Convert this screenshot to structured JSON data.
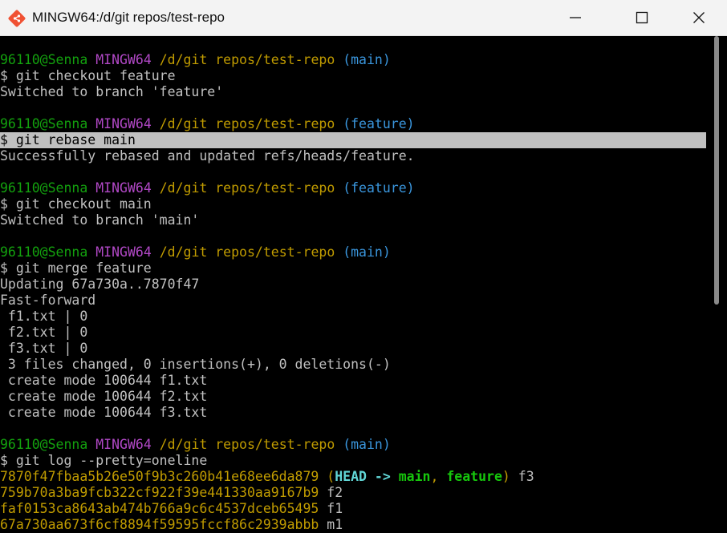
{
  "window": {
    "title": "MINGW64:/d/git repos/test-repo",
    "icon": "git-bash-icon",
    "controls": [
      "minimize-icon",
      "maximize-icon",
      "close-icon"
    ]
  },
  "colors": {
    "user": "#13a10e",
    "host": "#b148c6",
    "path": "#c19c00",
    "branch": "#3a96dd",
    "text": "#c0c0c0",
    "hash": "#c19c00",
    "head": "#61d6d6",
    "ref": "#16c60c",
    "selection_bg": "#c0c0c0"
  },
  "lines": [
    {
      "segs": [
        {
          "t": "96110@Senna",
          "c": "user"
        },
        {
          "t": " "
        },
        {
          "t": "MINGW64",
          "c": "host"
        },
        {
          "t": " "
        },
        {
          "t": "/d/git repos/test-repo",
          "c": "path"
        },
        {
          "t": " "
        },
        {
          "t": "(main)",
          "c": "branch"
        }
      ]
    },
    {
      "segs": [
        {
          "t": "$ git checkout feature"
        }
      ]
    },
    {
      "segs": [
        {
          "t": "Switched to branch 'feature'"
        }
      ]
    },
    {
      "segs": [
        {
          "t": ""
        }
      ]
    },
    {
      "segs": [
        {
          "t": "96110@Senna",
          "c": "user"
        },
        {
          "t": " "
        },
        {
          "t": "MINGW64",
          "c": "host"
        },
        {
          "t": " "
        },
        {
          "t": "/d/git repos/test-repo",
          "c": "path"
        },
        {
          "t": " "
        },
        {
          "t": "(feature)",
          "c": "branch"
        }
      ]
    },
    {
      "hl": true,
      "segs": [
        {
          "t": "$ git rebase main"
        }
      ]
    },
    {
      "segs": [
        {
          "t": "Successfully rebased and updated refs/heads/feature."
        }
      ]
    },
    {
      "segs": [
        {
          "t": ""
        }
      ]
    },
    {
      "segs": [
        {
          "t": "96110@Senna",
          "c": "user"
        },
        {
          "t": " "
        },
        {
          "t": "MINGW64",
          "c": "host"
        },
        {
          "t": " "
        },
        {
          "t": "/d/git repos/test-repo",
          "c": "path"
        },
        {
          "t": " "
        },
        {
          "t": "(feature)",
          "c": "branch"
        }
      ]
    },
    {
      "segs": [
        {
          "t": "$ git checkout main"
        }
      ]
    },
    {
      "segs": [
        {
          "t": "Switched to branch 'main'"
        }
      ]
    },
    {
      "segs": [
        {
          "t": ""
        }
      ]
    },
    {
      "segs": [
        {
          "t": "96110@Senna",
          "c": "user"
        },
        {
          "t": " "
        },
        {
          "t": "MINGW64",
          "c": "host"
        },
        {
          "t": " "
        },
        {
          "t": "/d/git repos/test-repo",
          "c": "path"
        },
        {
          "t": " "
        },
        {
          "t": "(main)",
          "c": "branch"
        }
      ]
    },
    {
      "segs": [
        {
          "t": "$ git merge feature"
        }
      ]
    },
    {
      "segs": [
        {
          "t": "Updating 67a730a..7870f47"
        }
      ]
    },
    {
      "segs": [
        {
          "t": "Fast-forward"
        }
      ]
    },
    {
      "segs": [
        {
          "t": " f1.txt | 0"
        }
      ]
    },
    {
      "segs": [
        {
          "t": " f2.txt | 0"
        }
      ]
    },
    {
      "segs": [
        {
          "t": " f3.txt | 0"
        }
      ]
    },
    {
      "segs": [
        {
          "t": " 3 files changed, 0 insertions(+), 0 deletions(-)"
        }
      ]
    },
    {
      "segs": [
        {
          "t": " create mode 100644 f1.txt"
        }
      ]
    },
    {
      "segs": [
        {
          "t": " create mode 100644 f2.txt"
        }
      ]
    },
    {
      "segs": [
        {
          "t": " create mode 100644 f3.txt"
        }
      ]
    },
    {
      "segs": [
        {
          "t": ""
        }
      ]
    },
    {
      "segs": [
        {
          "t": "96110@Senna",
          "c": "user"
        },
        {
          "t": " "
        },
        {
          "t": "MINGW64",
          "c": "host"
        },
        {
          "t": " "
        },
        {
          "t": "/d/git repos/test-repo",
          "c": "path"
        },
        {
          "t": " "
        },
        {
          "t": "(main)",
          "c": "branch"
        }
      ]
    },
    {
      "segs": [
        {
          "t": "$ git log --pretty=oneline"
        }
      ]
    },
    {
      "segs": [
        {
          "t": "7870f47fbaa5b26e50f9b3c260b41e68ee6da879",
          "c": "hash"
        },
        {
          "t": " "
        },
        {
          "t": "(",
          "c": "hash"
        },
        {
          "t": "HEAD -> ",
          "c": "head",
          "b": true
        },
        {
          "t": "main",
          "c": "ref",
          "b": true
        },
        {
          "t": ", ",
          "c": "hash"
        },
        {
          "t": "feature",
          "c": "ref",
          "b": true
        },
        {
          "t": ")",
          "c": "hash"
        },
        {
          "t": " f3"
        }
      ]
    },
    {
      "segs": [
        {
          "t": "759b70a3ba9fcb322cf922f39e441330aa9167b9",
          "c": "hash"
        },
        {
          "t": " f2"
        }
      ]
    },
    {
      "segs": [
        {
          "t": "faf0153ca8643ab474b766a9c6c4537dceb65495",
          "c": "hash"
        },
        {
          "t": " f1"
        }
      ]
    },
    {
      "segs": [
        {
          "t": "67a730aa673f6cf8894f59595fccf86c2939abbb",
          "c": "hash"
        },
        {
          "t": " m1"
        }
      ]
    }
  ]
}
